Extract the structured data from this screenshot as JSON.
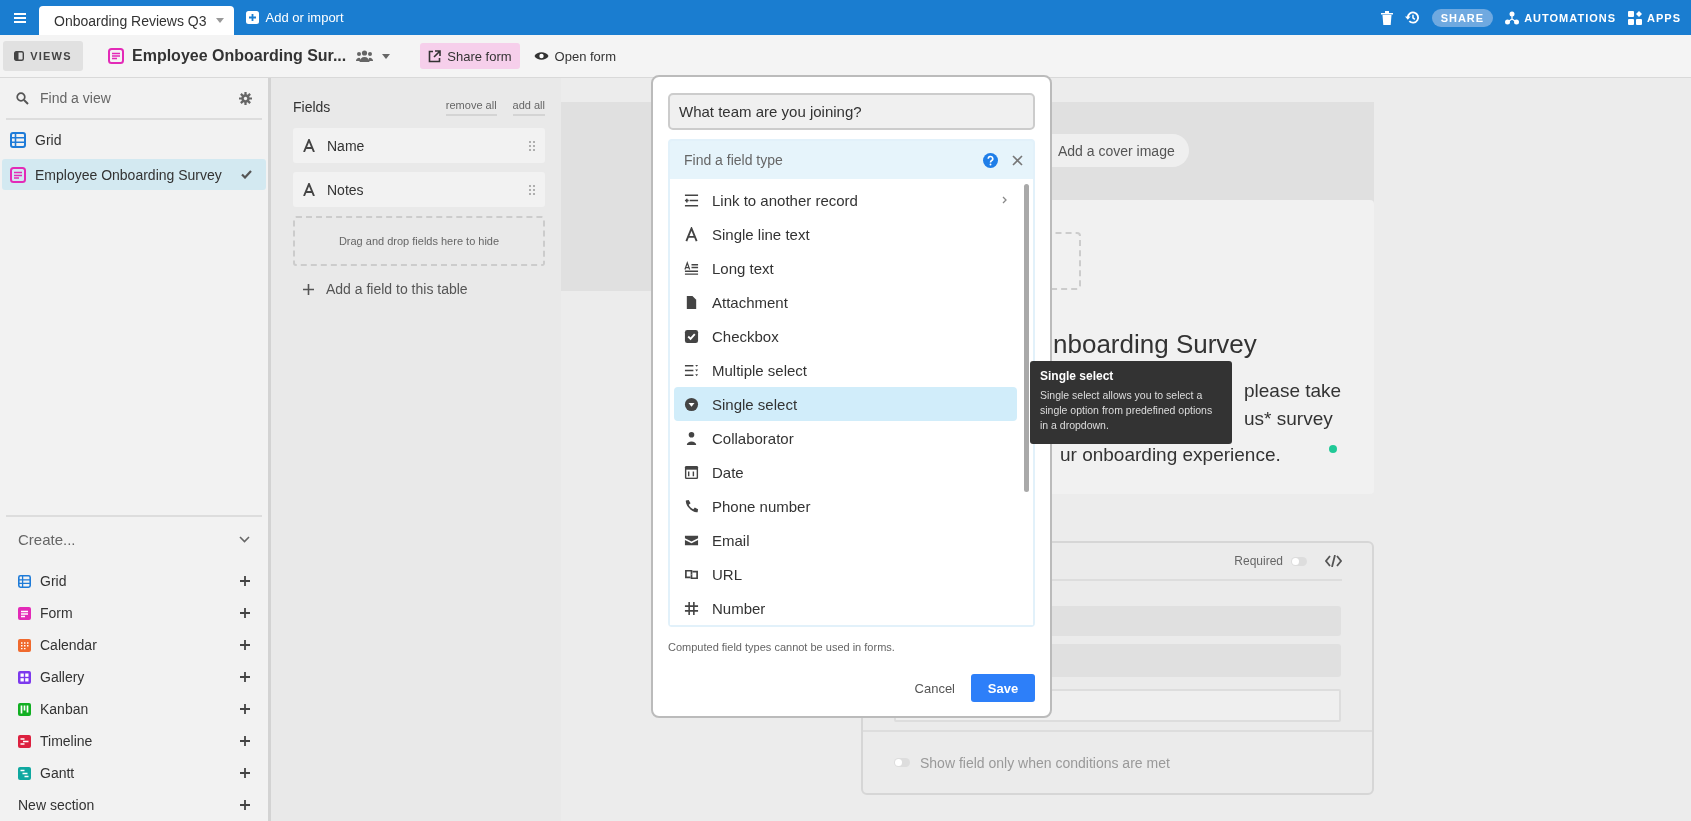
{
  "topbar": {
    "base_tab": {
      "label": "Onboarding Reviews Q3",
      "selected": true
    },
    "add_import": "Add or import",
    "share": "SHARE",
    "automations": "AUTOMATIONS",
    "apps": "APPS"
  },
  "viewbar": {
    "views_button": "VIEWS",
    "view_name": "Employee Onboarding Sur...",
    "actions": [
      {
        "label": "Share form",
        "kind": "share",
        "selected": true
      },
      {
        "label": "Open form",
        "kind": "open",
        "selected": false
      }
    ]
  },
  "sidebar": {
    "search_placeholder": "Find a view",
    "views": [
      {
        "label": "Grid",
        "kind": "grid",
        "color": "#1e7bd8",
        "selected": false
      },
      {
        "label": "Employee Onboarding Survey",
        "kind": "form",
        "color": "#e32ab7",
        "selected": true
      }
    ],
    "create_title": "Create...",
    "create_items": [
      {
        "label": "Grid",
        "kind": "grid",
        "color": "#1e7bd8"
      },
      {
        "label": "Form",
        "kind": "form",
        "color": "#e32ab7"
      },
      {
        "label": "Calendar",
        "kind": "calendar",
        "color": "#f06a2e"
      },
      {
        "label": "Gallery",
        "kind": "gallery",
        "color": "#7c39ed"
      },
      {
        "label": "Kanban",
        "kind": "kanban",
        "color": "#11af22"
      },
      {
        "label": "Timeline",
        "kind": "timeline",
        "color": "#dc213f"
      },
      {
        "label": "Gantt",
        "kind": "gantt",
        "color": "#0fa8a0"
      }
    ],
    "new_section": "New section"
  },
  "fields_panel": {
    "title": "Fields",
    "remove_all": "remove all",
    "add_all": "add all",
    "fields": [
      {
        "label": "Name"
      },
      {
        "label": "Notes"
      }
    ],
    "drop_hint": "Drag and drop fields here to hide",
    "add_field": "Add a field to this table"
  },
  "form": {
    "cover_button": "Add a cover image",
    "title_fragment": "nboarding Survey",
    "description_fragments": [
      "please take",
      "us* survey",
      "ur onboarding experience."
    ],
    "field_card": {
      "required_label": "Required",
      "required_on": false,
      "condition_label": "Show field only when conditions are met",
      "condition_on": false
    }
  },
  "dialog": {
    "field_name": "What team are you joining?",
    "type_search_placeholder": "Find a field type",
    "field_types": [
      {
        "label": "Link to another record",
        "kind": "link",
        "submenu": true,
        "selected": false
      },
      {
        "label": "Single line text",
        "kind": "text",
        "submenu": false,
        "selected": false
      },
      {
        "label": "Long text",
        "kind": "longtext",
        "submenu": false,
        "selected": false
      },
      {
        "label": "Attachment",
        "kind": "attachment",
        "submenu": false,
        "selected": false
      },
      {
        "label": "Checkbox",
        "kind": "checkbox",
        "submenu": false,
        "selected": false
      },
      {
        "label": "Multiple select",
        "kind": "multiselect",
        "submenu": false,
        "selected": false
      },
      {
        "label": "Single select",
        "kind": "singleselect",
        "submenu": false,
        "selected": true
      },
      {
        "label": "Collaborator",
        "kind": "user",
        "submenu": false,
        "selected": false
      },
      {
        "label": "Date",
        "kind": "date",
        "submenu": false,
        "selected": false
      },
      {
        "label": "Phone number",
        "kind": "phone",
        "submenu": false,
        "selected": false
      },
      {
        "label": "Email",
        "kind": "email",
        "submenu": false,
        "selected": false
      },
      {
        "label": "URL",
        "kind": "url",
        "submenu": false,
        "selected": false
      },
      {
        "label": "Number",
        "kind": "number",
        "submenu": false,
        "selected": false
      }
    ],
    "note": "Computed field types cannot be used in forms.",
    "cancel": "Cancel",
    "save": "Save"
  },
  "tooltip": {
    "title": "Single select",
    "text": "Single select allows you to select a single option from predefined options in a dropdown."
  }
}
